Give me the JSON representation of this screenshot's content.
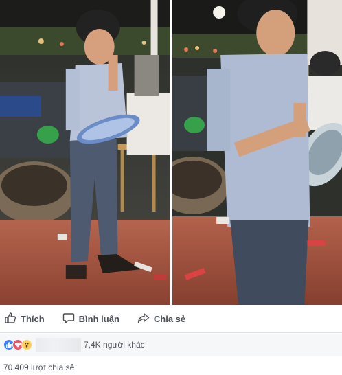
{
  "actions": {
    "like_label": "Thích",
    "comment_label": "Bình luận",
    "share_label": "Chia sẻ"
  },
  "reactions": {
    "icons": [
      "like-icon",
      "love-icon",
      "wow-icon"
    ],
    "others_text": "7,4K người khác"
  },
  "shares": {
    "text": "70.409 lượt chia sẻ"
  },
  "colors": {
    "like": "#4080ff",
    "love": "#f25268",
    "wow": "#fcd05b",
    "action_text": "#4b4f56"
  }
}
